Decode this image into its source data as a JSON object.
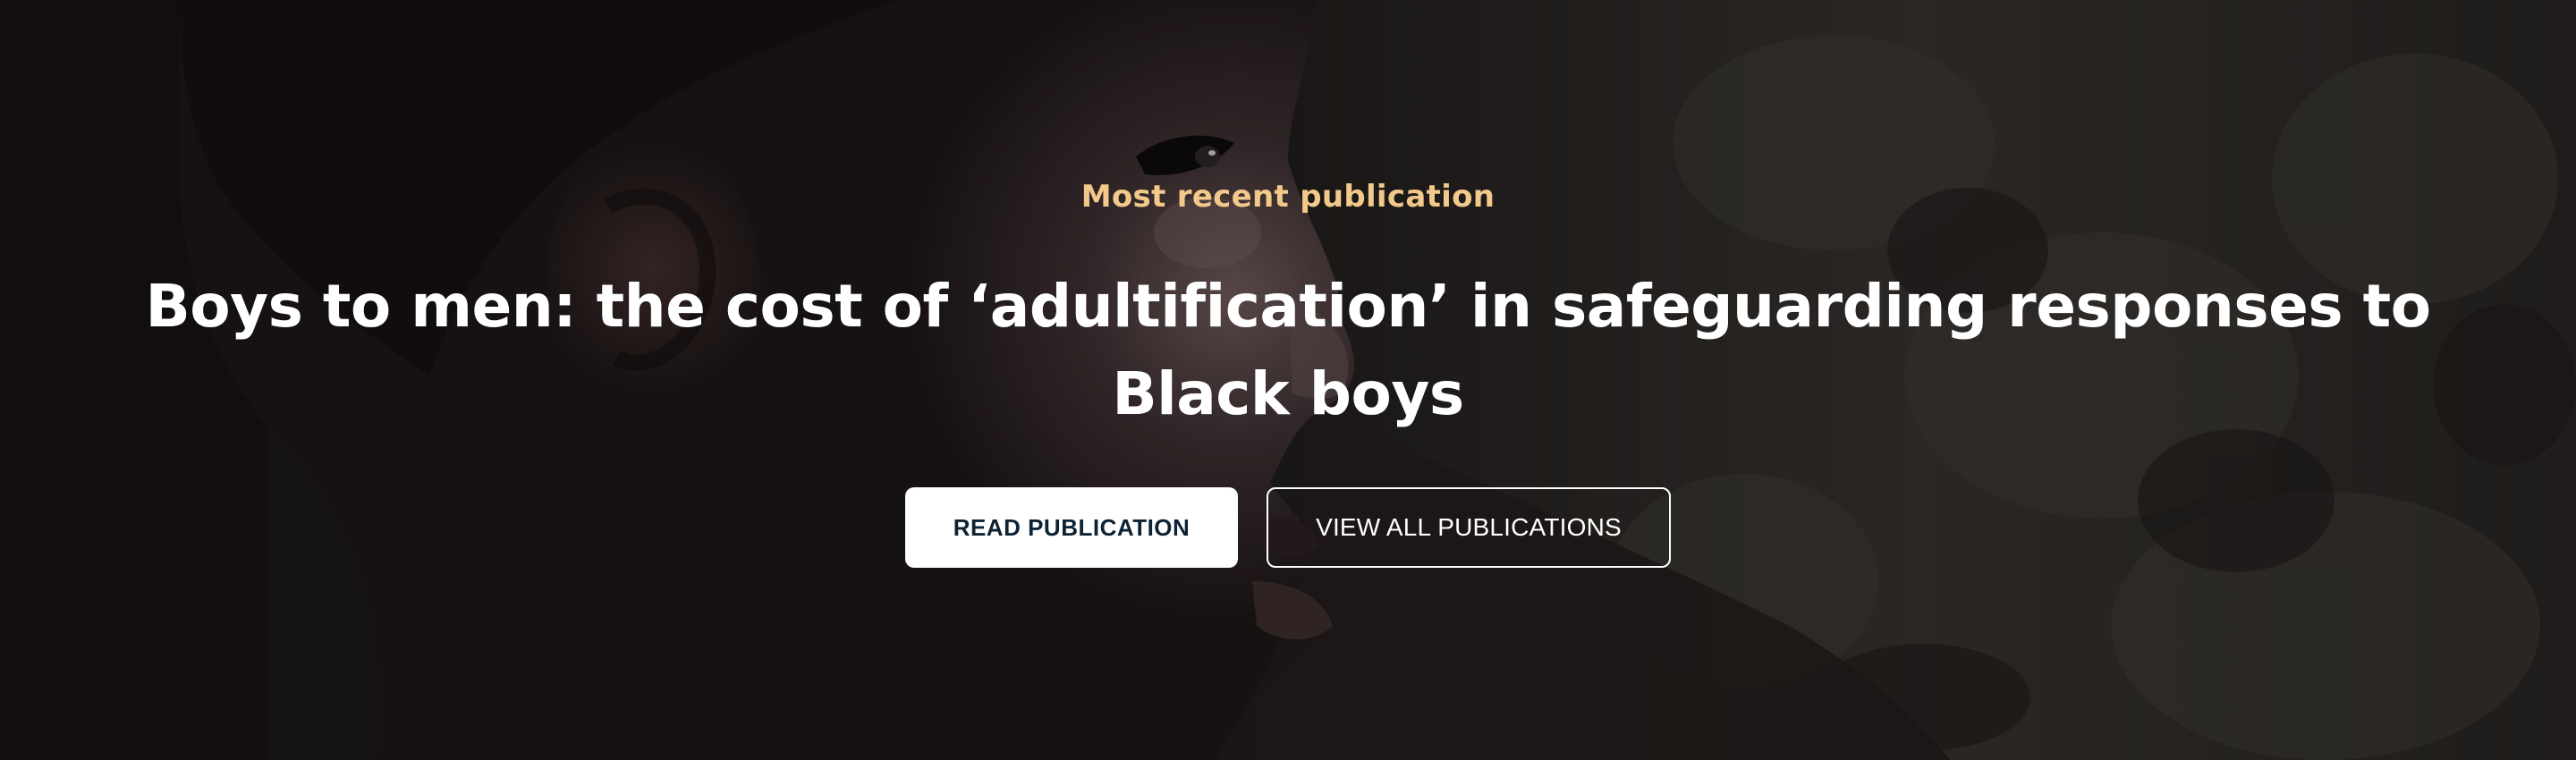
{
  "hero": {
    "eyebrow": "Most recent publication",
    "title": "Boys to men: the cost of ‘adultification’ in safeguarding responses to Black boys",
    "primary_button_label": "READ PUBLICATION",
    "secondary_button_label": "VIEW ALL PUBLICATIONS"
  },
  "colors": {
    "eyebrow": "#f2c98a",
    "title": "#ffffff",
    "primary_button_bg": "#ffffff",
    "primary_button_text": "#0d2233",
    "secondary_button_border": "#ffffff"
  },
  "background_image": "portrait-of-boy-in-profile"
}
